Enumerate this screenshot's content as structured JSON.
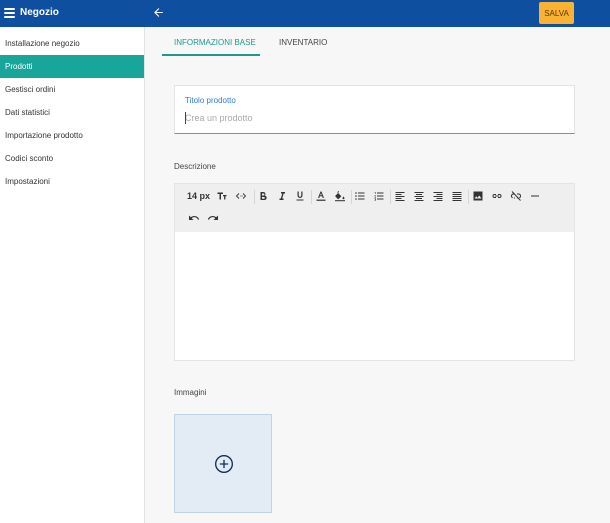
{
  "header": {
    "title": "Negozio",
    "save_label": "SALVA"
  },
  "sidebar": {
    "items": [
      {
        "label": "Installazione negozio",
        "active": false
      },
      {
        "label": "Prodotti",
        "active": true
      },
      {
        "label": "Gestisci ordini",
        "active": false
      },
      {
        "label": "Dati statistici",
        "active": false
      },
      {
        "label": "Importazione prodotto",
        "active": false
      },
      {
        "label": "Codici sconto",
        "active": false
      },
      {
        "label": "Impostazioni",
        "active": false
      }
    ]
  },
  "tabs": [
    {
      "label": "INFORMAZIONI BASE",
      "active": true
    },
    {
      "label": "INVENTARIO",
      "active": false
    }
  ],
  "form": {
    "title_label": "Titolo prodotto",
    "title_placeholder": "Crea un prodotto",
    "title_value": "",
    "description_label": "Descrizione",
    "images_label": "Immagini"
  },
  "editor": {
    "font_size": "14 px",
    "toolbar_icons": [
      "text-size-icon",
      "code-icon",
      "bold-icon",
      "italic-icon",
      "underline-icon",
      "text-color-icon",
      "fill-color-icon",
      "bullet-list-icon",
      "numbered-list-icon",
      "align-left-icon",
      "align-center-icon",
      "align-right-icon",
      "align-justify-icon",
      "image-icon",
      "link-icon",
      "unlink-icon",
      "horizontal-rule-icon",
      "undo-icon",
      "redo-icon"
    ]
  },
  "colors": {
    "header": "#0f4fa0",
    "accent": "#18a59a",
    "save_button": "#f9b232",
    "field_focus": "#2f7ed8"
  }
}
